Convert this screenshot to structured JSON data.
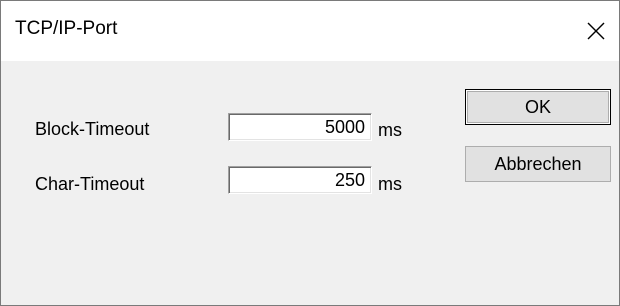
{
  "window": {
    "title": "TCP/IP-Port"
  },
  "fields": {
    "block_timeout": {
      "label": "Block-Timeout",
      "value": "5000",
      "unit": "ms"
    },
    "char_timeout": {
      "label": "Char-Timeout",
      "value": "250",
      "unit": "ms"
    }
  },
  "buttons": {
    "ok_label": "OK",
    "cancel_label": "Abbrechen"
  },
  "icons": {
    "close": "close-icon"
  }
}
